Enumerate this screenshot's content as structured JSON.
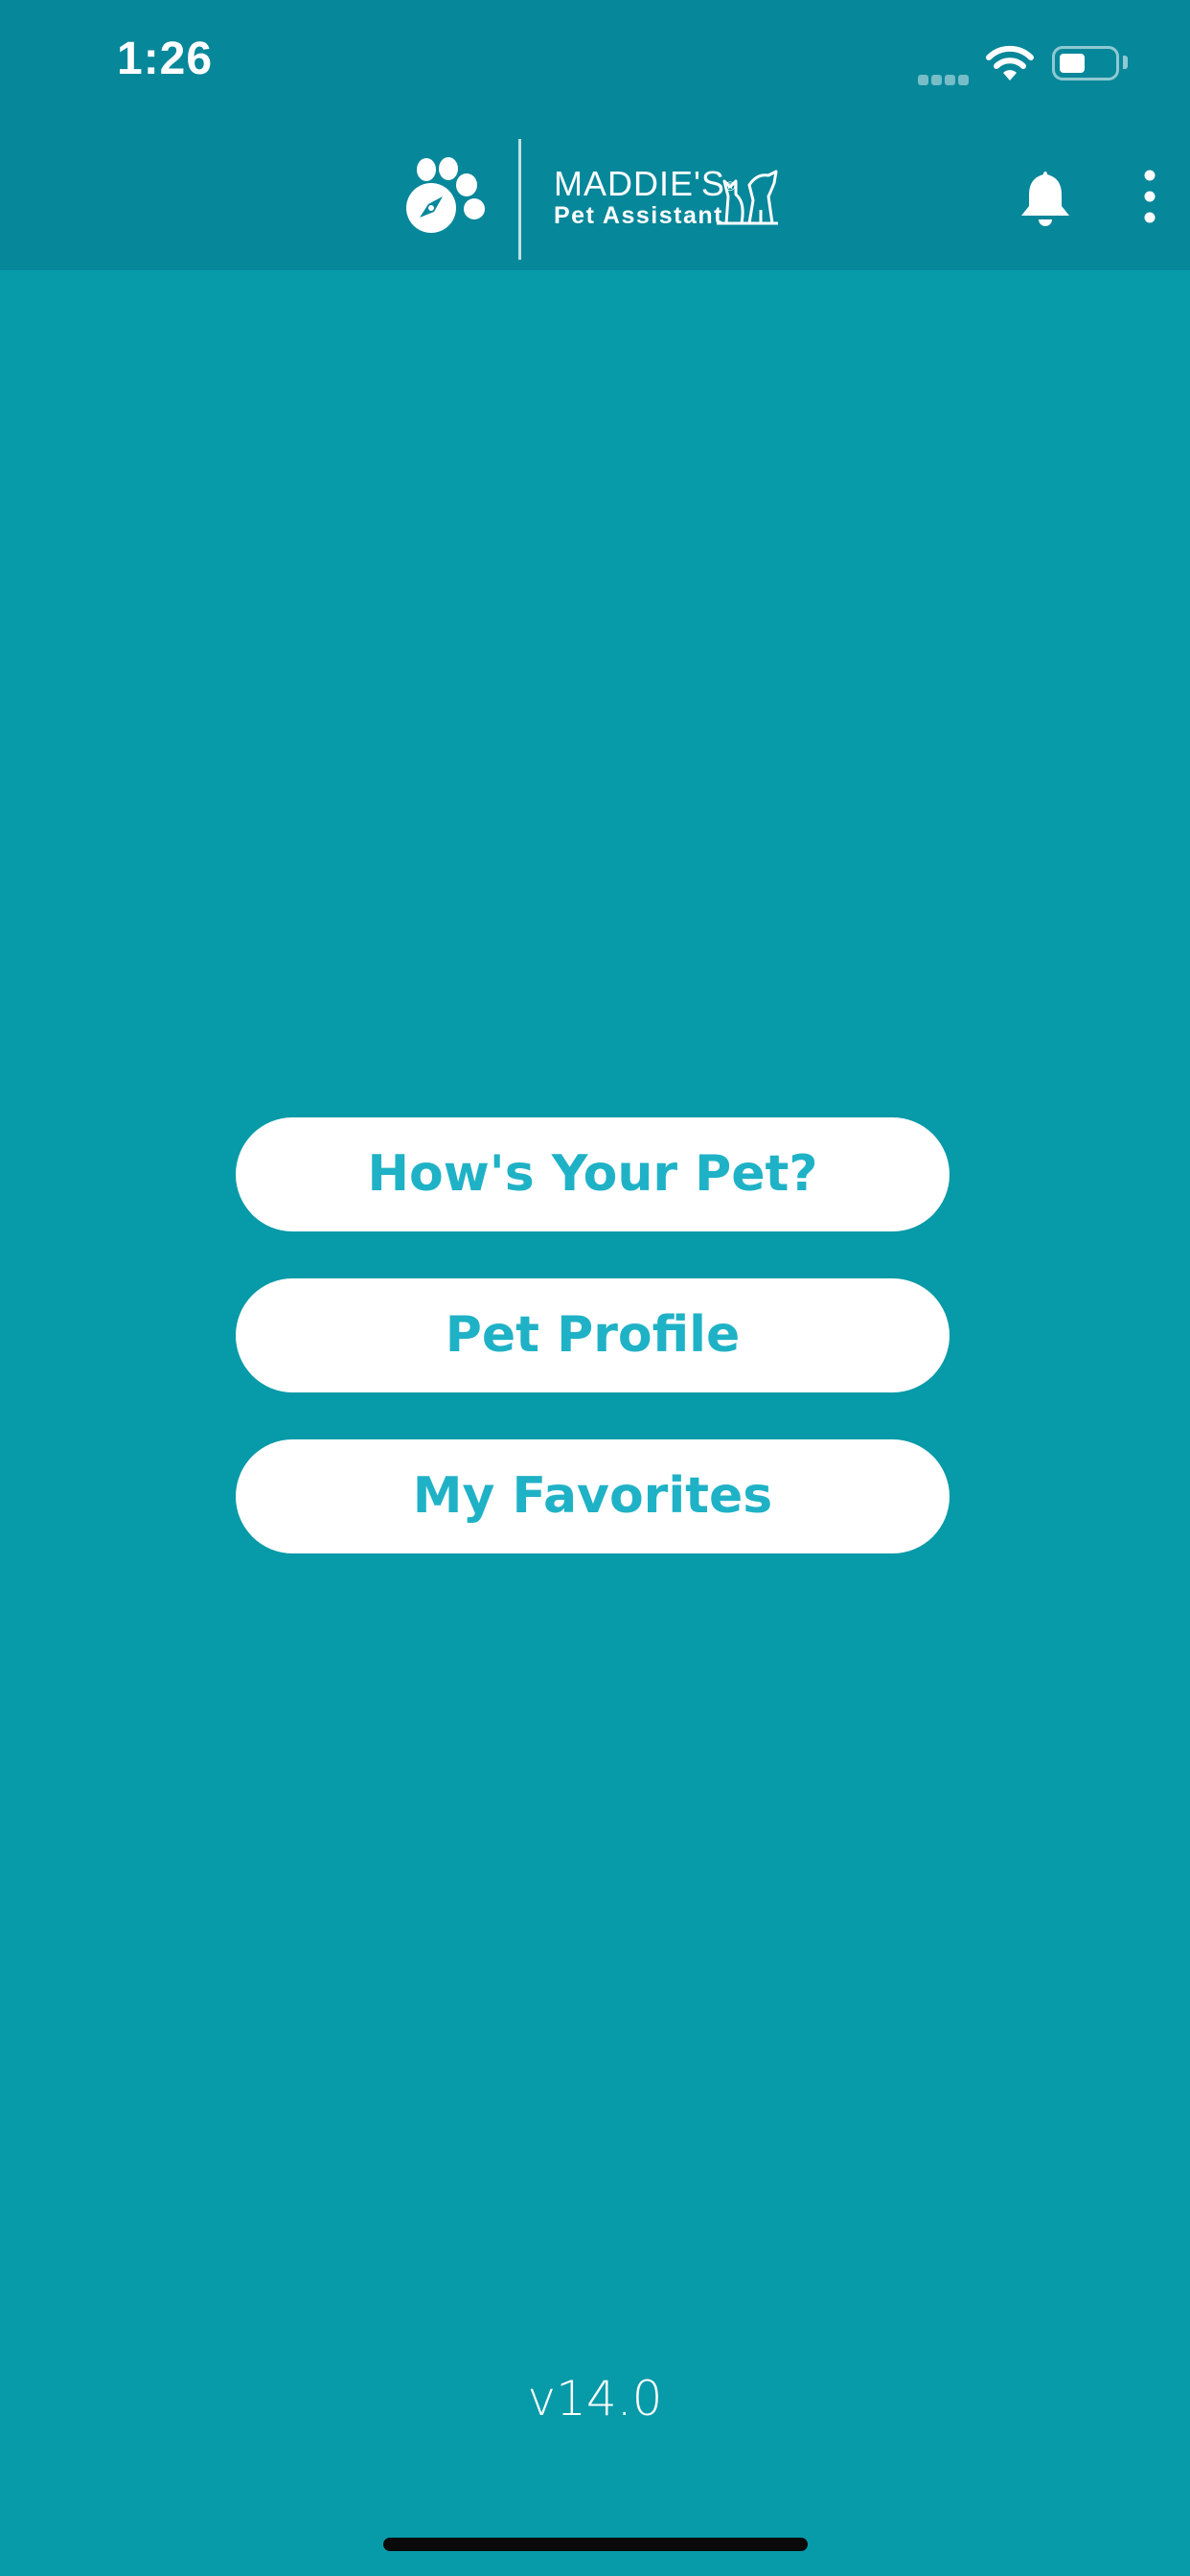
{
  "status_bar": {
    "time": "1:26"
  },
  "header": {
    "logo": {
      "name_line1": "MADDIE'S",
      "registered_mark": "®",
      "name_line2": "Pet Assistant"
    },
    "icons": [
      "paw-compass-icon",
      "pets-icon",
      "bell-icon",
      "more-vertical-icon"
    ]
  },
  "menu": {
    "buttons": [
      {
        "label": "How's Your Pet?"
      },
      {
        "label": "Pet Profile"
      },
      {
        "label": "My Favorites"
      }
    ]
  },
  "footer": {
    "version": "v14.0"
  },
  "colors": {
    "background": "#079aa8",
    "header_background": "#07879a",
    "button_background": "#ffffff",
    "button_text": "#1fb2c6"
  }
}
